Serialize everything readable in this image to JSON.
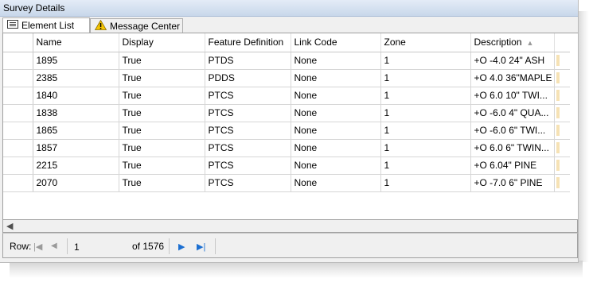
{
  "window": {
    "title": "Survey Details"
  },
  "tabs": [
    {
      "label": "Element List",
      "icon": "list-icon"
    },
    {
      "label": "Message Center",
      "icon": "warning-icon"
    }
  ],
  "grid": {
    "columns": [
      "Name",
      "Display",
      "Feature Definition",
      "Link Code",
      "Zone",
      "Description"
    ],
    "sorted_column": "Description",
    "sort_direction": "ascending",
    "rows": [
      {
        "name": "1895",
        "display": "True",
        "feature": "PTDS",
        "link": "None",
        "zone": "1",
        "desc": "+O -4.0 24\" ASH"
      },
      {
        "name": "2385",
        "display": "True",
        "feature": "PDDS",
        "link": "None",
        "zone": "1",
        "desc": "+O 4.0 36\"MAPLE"
      },
      {
        "name": "1840",
        "display": "True",
        "feature": "PTCS",
        "link": "None",
        "zone": "1",
        "desc": "+O 6.0 10\" TWI..."
      },
      {
        "name": "1838",
        "display": "True",
        "feature": "PTCS",
        "link": "None",
        "zone": "1",
        "desc": "+O -6.0 4\" QUA..."
      },
      {
        "name": "1865",
        "display": "True",
        "feature": "PTCS",
        "link": "None",
        "zone": "1",
        "desc": "+O -6.0 6\" TWI..."
      },
      {
        "name": "1857",
        "display": "True",
        "feature": "PTCS",
        "link": "None",
        "zone": "1",
        "desc": "+O 6.0 6\" TWIN..."
      },
      {
        "name": "2215",
        "display": "True",
        "feature": "PTCS",
        "link": "None",
        "zone": "1",
        "desc": "+O 6.04\" PINE"
      },
      {
        "name": "2070",
        "display": "True",
        "feature": "PTCS",
        "link": "None",
        "zone": "1",
        "desc": "+O -7.0 6\" PINE"
      }
    ]
  },
  "pager": {
    "row_label": "Row:",
    "current_row": "1",
    "of_label": "of 1576"
  },
  "colors": {
    "titlebar": "#c8d7ea",
    "accent": "#1c6fd1",
    "warning": "#f5c400"
  }
}
